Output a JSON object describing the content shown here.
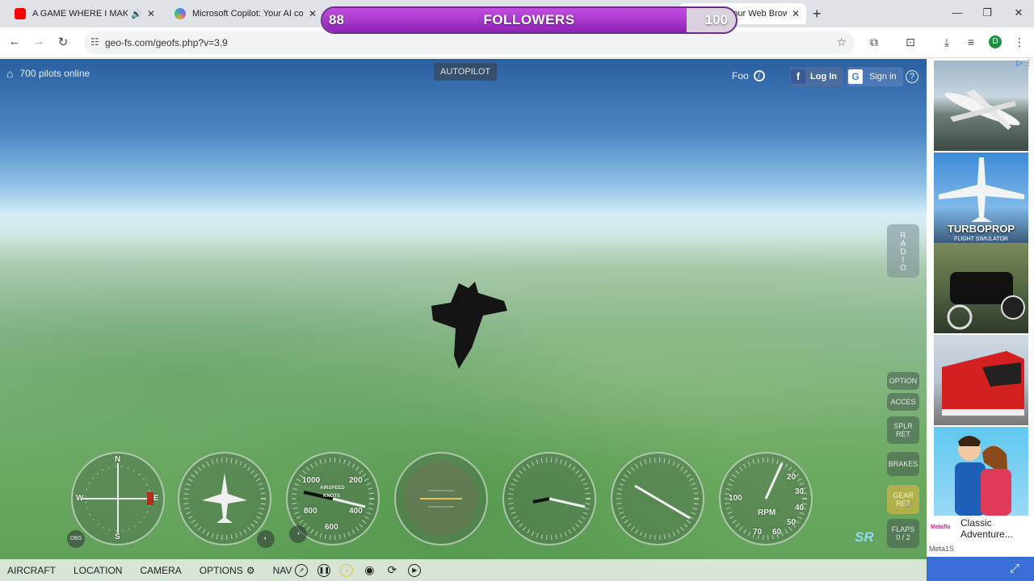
{
  "tabs": [
    {
      "title": "A GAME WHERE I MAKE MY",
      "close": "✕",
      "favicon_color": "#ff0000"
    },
    {
      "title": "Microsoft Copilot: Your AI com",
      "close": "✕",
      "favicon_color": "#3c8ff0"
    },
    {
      "title": "FS - Fly in Your Web Browse",
      "close": "✕"
    }
  ],
  "new_tab": "+",
  "followers_bar": {
    "current": "88",
    "label": "FOLLOWERS",
    "goal": "100",
    "progress": 0.88
  },
  "address": {
    "url": "geo-fs.com/geofs.php?v=3.9"
  },
  "profile_letter": "D",
  "game": {
    "pilots_online": "700 pilots online",
    "autopilot": "AUTOPILOT",
    "foo": "Foo",
    "facebook_login": "Log In",
    "google_signin": "Sign in",
    "help": "?",
    "radio": [
      "R",
      "A",
      "D",
      "I",
      "O"
    ],
    "side_buttons": {
      "option": "OPTION",
      "acces": "ACCES",
      "splr": "SPLR",
      "splr_sub": "RET",
      "brakes": "BRAKES",
      "gear": "GEAR",
      "gear_sub": "RET",
      "flaps": "FLAPS",
      "flaps_sub": "0 / 2"
    },
    "sr_logo": "SR",
    "obs": "OBS",
    "gauges": {
      "compass": {
        "n": "N",
        "s": "S",
        "e": "E",
        "w": "W"
      },
      "airspeed": {
        "label": "AIRSPEED",
        "unit": "KNOTS",
        "ticks": [
          "1000",
          "200",
          "800",
          "400",
          "600"
        ]
      },
      "rpm": {
        "label": "RPM",
        "ticks": [
          "100",
          "20",
          "30",
          "40",
          "50",
          "60",
          "70"
        ]
      }
    },
    "bottom_menu": [
      "AIRCRAFT",
      "LOCATION",
      "CAMERA",
      "OPTIONS",
      "NAV"
    ]
  },
  "ads": {
    "tile2_text": "TURBOPROP",
    "tile2_sub": "FLIGHT SIMULATOR",
    "tile5_caption": "Classic Adventure...",
    "tile5_logo": "Metaflo",
    "publisher": "Meta1S"
  }
}
